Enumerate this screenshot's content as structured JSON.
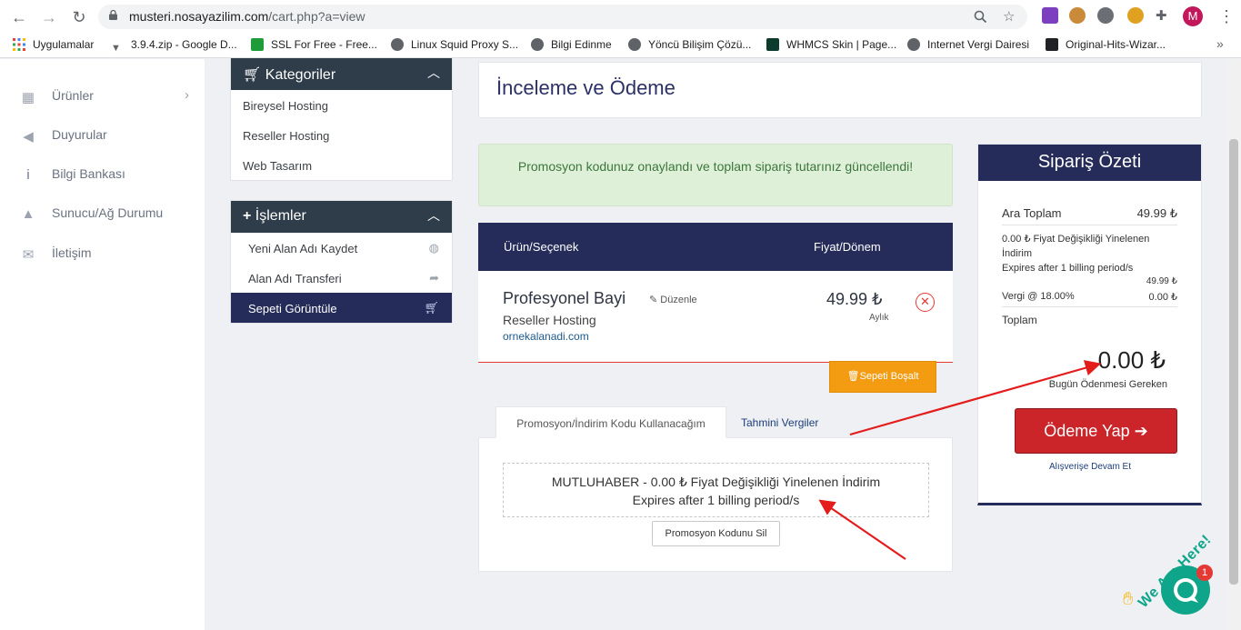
{
  "browser": {
    "url_host": "musteri.nosayazilim.com",
    "url_path": "/cart.php?a=view",
    "avatar_letter": "M",
    "bookmarks": [
      {
        "label": "Uygulamalar",
        "icon": "apps-grid-icon"
      },
      {
        "label": "3.9.4.zip - Google D...",
        "icon": "drive-icon"
      },
      {
        "label": "SSL For Free - Free...",
        "icon": "lock-icon"
      },
      {
        "label": "Linux Squid Proxy S...",
        "icon": "globe-icon"
      },
      {
        "label": "Bilgi Edinme",
        "icon": "globe-icon"
      },
      {
        "label": "Yöncü Bilişim Çözü...",
        "icon": "globe-icon"
      },
      {
        "label": "WHMCS Skin | Page...",
        "icon": "sn-icon"
      },
      {
        "label": "Internet Vergi Dairesi",
        "icon": "globe-icon"
      },
      {
        "label": "Original-Hits-Wizar...",
        "icon": "home-icon"
      }
    ],
    "bookmarks_more": "»"
  },
  "sidebar_nav": {
    "items": [
      {
        "label": "Ürünler",
        "icon": "store-icon"
      },
      {
        "label": "Duyurular",
        "icon": "megaphone-icon"
      },
      {
        "label": "Bilgi Bankası",
        "icon": "info-icon"
      },
      {
        "label": "Sunucu/Ağ Durumu",
        "icon": "warning-icon"
      },
      {
        "label": "İletişim",
        "icon": "envelope-icon"
      }
    ]
  },
  "categories_panel": {
    "title": "Kategoriler",
    "links": [
      "Bireysel Hosting",
      "Reseller Hosting",
      "Web Tasarım"
    ]
  },
  "actions_panel": {
    "title": "İşlemler",
    "links": [
      "Yeni Alan Adı Kaydet",
      "Alan Adı Transferi",
      "Sepeti Görüntüle"
    ]
  },
  "main": {
    "title": "İnceleme ve Ödeme",
    "alert": "Promosyon kodunuz onaylandı ve toplam sipariş tutarınız güncellendi!"
  },
  "cart": {
    "headers": {
      "product": "Ürün/Seçenek",
      "price": "Fiyat/Dönem"
    },
    "item": {
      "name": "Profesyonel Bayi",
      "edit": "Düzenle",
      "group": "Reseller Hosting",
      "domain": "ornekalanadi.com",
      "price": "49.99 ₺",
      "cycle": "Aylık"
    },
    "empty_button": "Sepeti Boşalt"
  },
  "tabs": {
    "promo": "Promosyon/İndirim Kodu Kullanacağım",
    "tax": "Tahmini Vergiler"
  },
  "promo": {
    "line1": "MUTLUHABER - 0.00 ₺ Fiyat Değişikliği Yinelenen İndirim",
    "line2": "Expires after 1 billing period/s",
    "remove_button": "Promosyon Kodunu Sil"
  },
  "summary": {
    "title": "Sipariş Özeti",
    "subtotal_label": "Ara Toplam",
    "subtotal_value": "49.99 ₺",
    "discount_line1": "0.00 ₺ Fiyat Değişikliği Yinelenen İndirim",
    "discount_line2": "Expires after 1 billing period/s",
    "discount_value": "49.99 ₺",
    "tax_label": "Vergi @ 18.00%",
    "tax_value": "0.00 ₺",
    "total_label": "Toplam",
    "total_amount": "0.00 ₺",
    "due_today": "Bugün Ödenmesi Gereken",
    "checkout_button": "Ödeme Yap",
    "continue_link": "Alışverişe Devam Et"
  },
  "chat": {
    "tagline": "We Are Here!",
    "badge": "1"
  },
  "colors": {
    "navy": "#252c5a",
    "panel_header": "#2f3c4a",
    "checkout_red": "#cc2529",
    "empty_orange": "#f39c12",
    "alert_green_bg": "#dff0d8",
    "chat_green": "#0fa58a",
    "annotation_red": "#e41c1c"
  }
}
